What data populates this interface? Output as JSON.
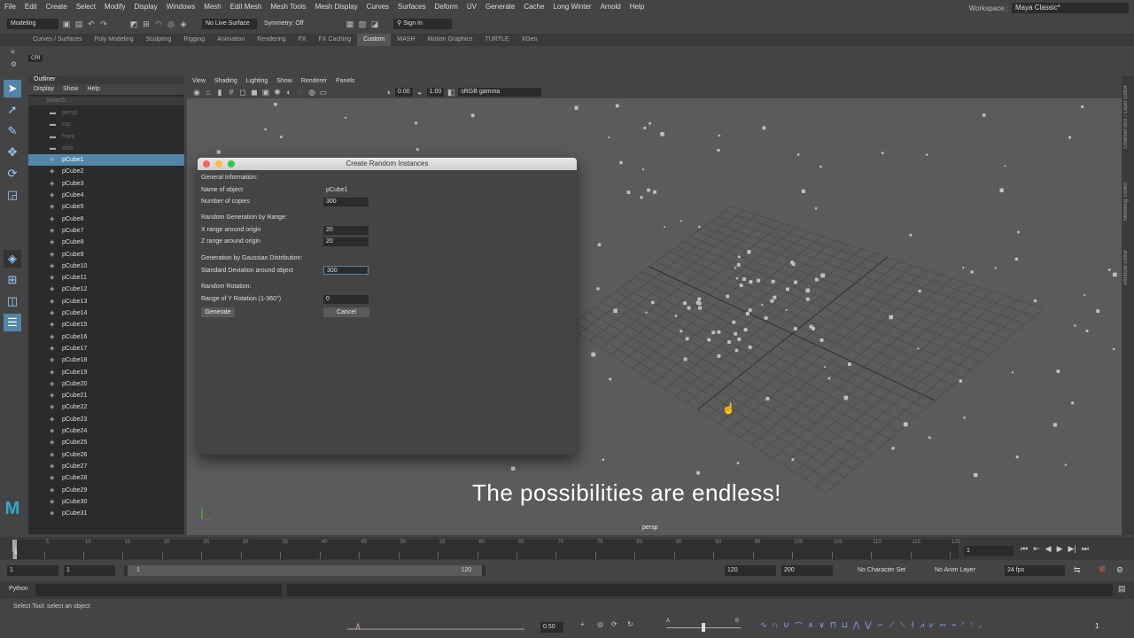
{
  "menubar": {
    "items": [
      "File",
      "Edit",
      "Create",
      "Select",
      "Modify",
      "Display",
      "Windows",
      "Mesh",
      "Edit Mesh",
      "Mesh Tools",
      "Mesh Display",
      "Curves",
      "Surfaces",
      "Deform",
      "UV",
      "Generate",
      "Cache",
      "Long Winter",
      "Arnold",
      "Help"
    ]
  },
  "workspace": {
    "label": "Workspace :",
    "value": "Maya Classic*"
  },
  "statusline": {
    "mode": "Modeling",
    "live_surface": "No Live Surface",
    "symmetry": "Symmetry: Off",
    "sign_in": "Sign In"
  },
  "shelf": {
    "tabs": [
      "Curves / Surfaces",
      "Poly Modeling",
      "Sculpting",
      "Rigging",
      "Animation",
      "Rendering",
      "FX",
      "FX Caching",
      "Custom",
      "MASH",
      "Motion Graphics",
      "TURTLE",
      "XGen"
    ],
    "active": "Custom",
    "button": "CRI"
  },
  "outliner": {
    "title": "Outliner",
    "menu": [
      "Display",
      "Show",
      "Help"
    ],
    "search_placeholder": "Search...",
    "cameras": [
      "persp",
      "top",
      "front",
      "side"
    ],
    "items": [
      "pCube1",
      "pCube2",
      "pCube3",
      "pCube4",
      "pCube5",
      "pCube6",
      "pCube7",
      "pCube8",
      "pCube9",
      "pCube10",
      "pCube11",
      "pCube12",
      "pCube13",
      "pCube14",
      "pCube15",
      "pCube16",
      "pCube17",
      "pCube18",
      "pCube19",
      "pCube20",
      "pCube21",
      "pCube22",
      "pCube23",
      "pCube24",
      "pCube25",
      "pCube26",
      "pCube27",
      "pCube28",
      "pCube29",
      "pCube30",
      "pCube31"
    ],
    "selected": "pCube1"
  },
  "viewport": {
    "menu": [
      "View",
      "Shading",
      "Lighting",
      "Show",
      "Renderer",
      "Panels"
    ],
    "value_a": "0.00",
    "value_b": "1.00",
    "color_space": "sRGB gamma",
    "camera": "persp"
  },
  "right_strip": {
    "labels": [
      "Channel Box / Layer Editor",
      "Modeling Toolkit",
      "Attribute Editor"
    ]
  },
  "dialog": {
    "title": "Create Random Instances",
    "section_general": "General Information:",
    "name_label": "Name of object",
    "name_value": "pCube1",
    "copies_label": "Number of copies",
    "copies_value": "300",
    "section_range": "Random Generation by Range:",
    "x_label": "X range around origin",
    "x_value": "20",
    "z_label": "Z range around origin",
    "z_value": "20",
    "section_gauss": "Generation by Gaussian Distribution:",
    "std_label": "Standard Deviation around object",
    "std_value": "300",
    "section_rot": "Random Rotation:",
    "rot_label": "Range of Y Rotation (1-360°)",
    "rot_value": "0",
    "generate": "Generate",
    "cancel": "Cancel"
  },
  "caption": "The possibilities are endless!",
  "timeline": {
    "ticks": [
      "1",
      "5",
      "10",
      "15",
      "20",
      "25",
      "30",
      "35",
      "40",
      "45",
      "50",
      "55",
      "60",
      "65",
      "70",
      "75",
      "80",
      "85",
      "90",
      "95",
      "100",
      "105",
      "110",
      "115",
      "120"
    ],
    "current_frame": "1"
  },
  "range": {
    "start": "1",
    "start2": "1",
    "slider_start": "1",
    "slider_end": "120",
    "end": "120",
    "end2": "200",
    "char_set": "No Character Set",
    "anim_layer": "No Anim Layer",
    "fps": "24 fps"
  },
  "cmdline": {
    "label": "Python"
  },
  "helpline": "Select Tool: select an object",
  "bottombar": {
    "value": "0.50",
    "right_value": "1"
  }
}
